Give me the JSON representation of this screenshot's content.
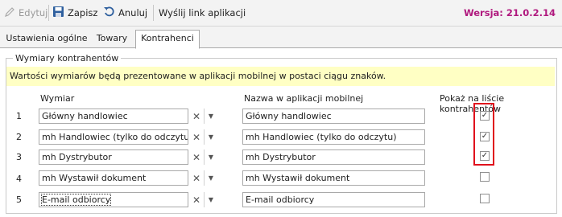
{
  "toolbar": {
    "edit_label": "Edytuj",
    "save_label": "Zapisz",
    "cancel_label": "Anuluj",
    "send_link_label": "Wyślij link aplikacji",
    "version": "Wersja: 21.0.2.14"
  },
  "tabs": [
    {
      "label": "Ustawienia ogólne",
      "active": false
    },
    {
      "label": "Towary",
      "active": false
    },
    {
      "label": "Kontrahenci",
      "active": true
    }
  ],
  "group": {
    "title": "Wymiary kontrahentów",
    "info": "Wartości wymiarów będą prezentowane w aplikacji mobilnej w postaci ciągu znaków.",
    "headers": {
      "dimension": "Wymiar",
      "mobile_name": "Nazwa w aplikacji mobilnej",
      "show_on_list": "Pokaż na liście kontrahentów"
    },
    "rows": [
      {
        "num": "1",
        "dimension": "Główny handlowiec",
        "mobile_name": "Główny handlowiec",
        "checked": true
      },
      {
        "num": "2",
        "dimension": "mh Handlowiec (tylko do odczytu)",
        "mobile_name": "mh Handlowiec (tylko do odczytu)",
        "checked": true
      },
      {
        "num": "3",
        "dimension": "mh Dystrybutor",
        "mobile_name": "mh Dystrybutor",
        "checked": true
      },
      {
        "num": "4",
        "dimension": "mh Wystawił dokument",
        "mobile_name": "mh Wystawił dokument",
        "checked": false
      },
      {
        "num": "5",
        "dimension": "E-mail odbiorcy",
        "mobile_name": "E-mail odbiorcy",
        "checked": false
      }
    ]
  },
  "icons": {
    "edit": "pencil-icon",
    "save": "floppy-disk-icon",
    "cancel": "undo-icon",
    "clear": "clear-x-icon",
    "dropdown": "chevron-down-icon",
    "check": "checkmark-icon"
  },
  "colors": {
    "version": "#b0197e",
    "info_background": "#ffffc4",
    "highlight": "#e0101c",
    "save_icon": "#2e5f9e"
  }
}
